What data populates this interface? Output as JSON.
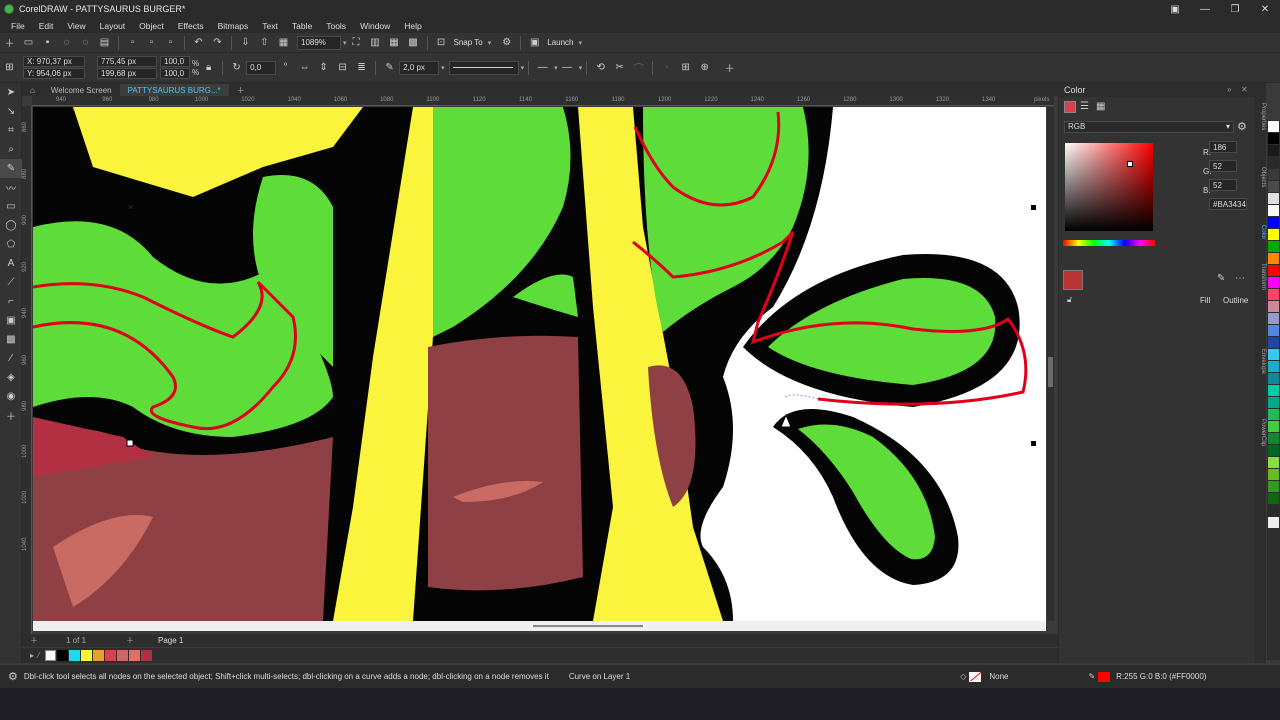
{
  "window": {
    "title": "CorelDRAW - PATTYSAURUS BURGER*"
  },
  "menu": [
    "File",
    "Edit",
    "View",
    "Layout",
    "Object",
    "Effects",
    "Bitmaps",
    "Text",
    "Table",
    "Tools",
    "Window",
    "Help"
  ],
  "toolbar": {
    "zoom": "1089%",
    "snap_label": "Snap To",
    "launch_label": "Launch"
  },
  "propbar": {
    "x": "X: 970,37 px",
    "y": "Y: 954,06 px",
    "w": "775,45 px",
    "h": "199,68 px",
    "scale_x": "100,0",
    "scale_y": "100,0",
    "pct": "%",
    "rotation": "0,0",
    "outline_width": "2,0 px"
  },
  "tabs": [
    "Welcome Screen",
    "PATTYSAURUS BURG...*"
  ],
  "ruler": {
    "h_labels": [
      "940",
      "960",
      "980",
      "1000",
      "1020",
      "1040",
      "1060",
      "1080",
      "1100",
      "1120",
      "1140",
      "1160",
      "1180",
      "1200",
      "1220",
      "1240",
      "1260",
      "1280",
      "1300",
      "1320",
      "1340"
    ],
    "unit": "pixels",
    "v_labels": [
      "860",
      "880",
      "900",
      "920",
      "940",
      "960",
      "980",
      "1000",
      "1020",
      "1040"
    ]
  },
  "pagenav": {
    "count": "1 of 1",
    "page": "Page 1"
  },
  "status": {
    "hint": "Dbl-click tool selects all nodes on the selected object; Shift+click multi-selects; dbl-clicking on a curve adds a node; dbl-clicking on a node removes it",
    "layer": "Curve on Layer 1",
    "fill": "None",
    "outline": "R:255 G:0 B:0 (#FF0000)"
  },
  "color_docker": {
    "title": "Color",
    "model": "RGB",
    "r_label": "R:",
    "r": "186",
    "g_label": "G:",
    "g": "52",
    "b_label": "B:",
    "b": "52",
    "hex": "#BA3434",
    "fill_label": "Fill",
    "outline_label": "Outline",
    "current_color": "#BA3434"
  },
  "side_tabs": [
    "Properties",
    "Objects",
    "Color",
    "Transform",
    "Envelope",
    "PowerClip"
  ],
  "colors": {
    "accent": "#4fc3f7",
    "selection": "#e0001b",
    "green": "#5ddc3a",
    "yellow": "#fbf43c",
    "brown": "#8f4045",
    "black": "#050505"
  }
}
